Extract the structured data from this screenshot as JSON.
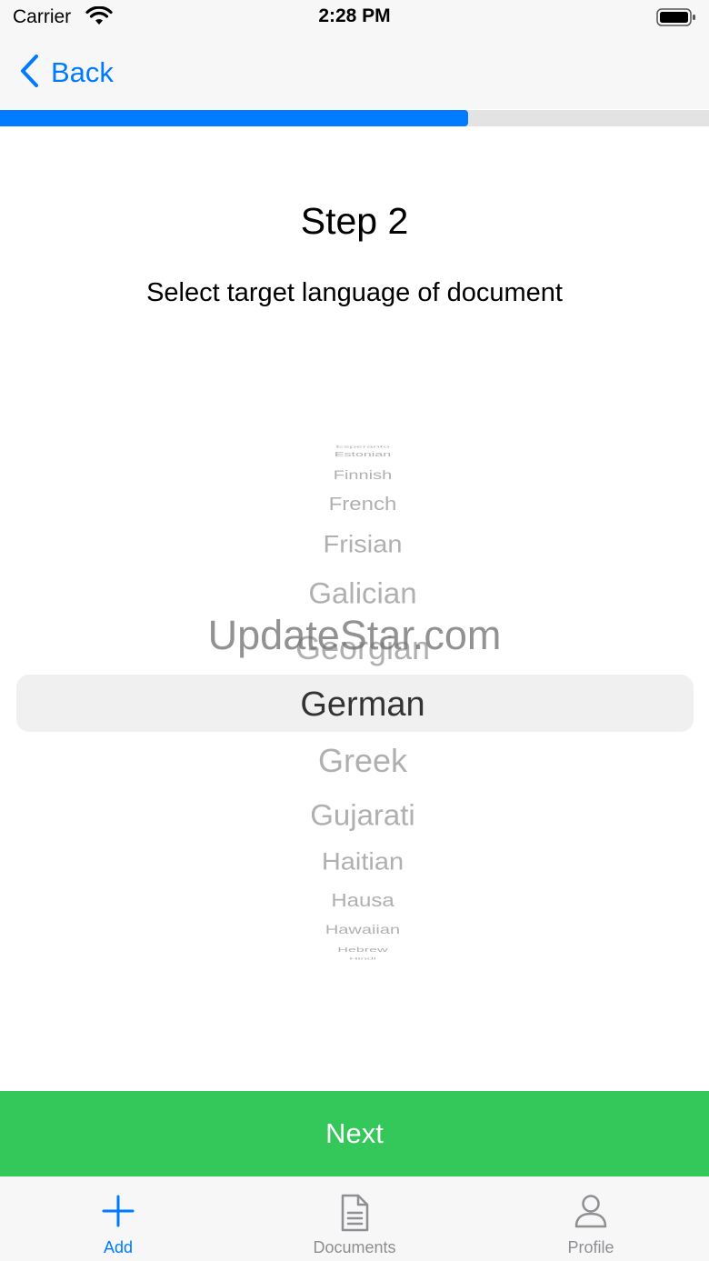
{
  "status_bar": {
    "carrier": "Carrier",
    "time": "2:28 PM"
  },
  "nav": {
    "back_label": "Back"
  },
  "progress": {
    "fraction": 0.66
  },
  "step": {
    "title": "Step 2",
    "subtitle": "Select target language of document"
  },
  "picker": {
    "items": [
      "Esperanto",
      "Estonian",
      "Finnish",
      "French",
      "Frisian",
      "Galician",
      "Georgian",
      "German",
      "Greek",
      "Gujarati",
      "Haitian",
      "Hausa",
      "Hawaiian",
      "Hebrew",
      "Hindi"
    ],
    "selected": "German"
  },
  "watermark": "UpdateStar.com",
  "next_button": {
    "label": "Next"
  },
  "tabs": [
    {
      "label": "Add",
      "icon": "plus-icon",
      "active": true
    },
    {
      "label": "Documents",
      "icon": "document-icon",
      "active": false
    },
    {
      "label": "Profile",
      "icon": "person-icon",
      "active": false
    }
  ],
  "colors": {
    "accent": "#007aff",
    "next": "#34c759",
    "inactive": "#8e8e93"
  }
}
